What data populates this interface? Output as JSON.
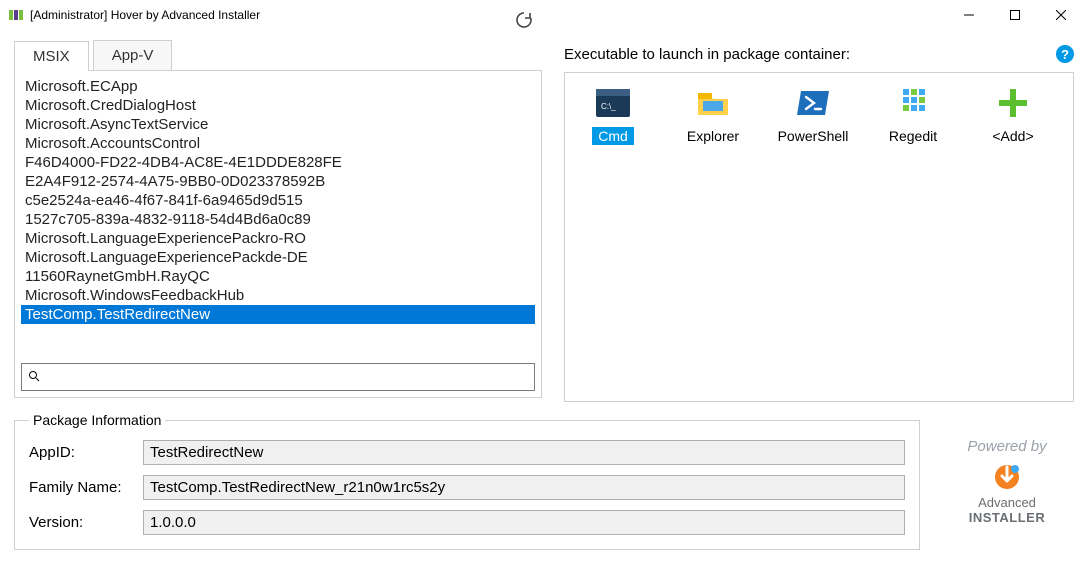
{
  "window": {
    "title": "[Administrator] Hover by Advanced Installer"
  },
  "tabs": {
    "msix": "MSIX",
    "appv": "App-V"
  },
  "packages": [
    "Microsoft.ECApp",
    "Microsoft.CredDialogHost",
    "Microsoft.AsyncTextService",
    "Microsoft.AccountsControl",
    "F46D4000-FD22-4DB4-AC8E-4E1DDDE828FE",
    "E2A4F912-2574-4A75-9BB0-0D023378592B",
    "c5e2524a-ea46-4f67-841f-6a9465d9d515",
    "1527c705-839a-4832-9118-54d4Bd6a0c89",
    "Microsoft.LanguageExperiencePackro-RO",
    "Microsoft.LanguageExperiencePackde-DE",
    "11560RaynetGmbH.RayQC",
    "Microsoft.WindowsFeedbackHub",
    "TestComp.TestRedirectNew"
  ],
  "selected_package_index": 12,
  "search": {
    "placeholder": ""
  },
  "exec_header": "Executable to launch in package container:",
  "launchers": {
    "cmd": "Cmd",
    "explorer": "Explorer",
    "powershell": "PowerShell",
    "regedit": "Regedit",
    "add": "<Add>"
  },
  "selected_launcher": "cmd",
  "pkginfo": {
    "legend": "Package Information",
    "appid_label": "AppID:",
    "appid_value": "TestRedirectNew",
    "family_label": "Family Name:",
    "family_value": "TestComp.TestRedirectNew_r21n0w1rc5s2y",
    "version_label": "Version:",
    "version_value": "1.0.0.0"
  },
  "powered": {
    "text": "Powered by",
    "line1": "Advanced",
    "line2": "INSTALLER"
  }
}
